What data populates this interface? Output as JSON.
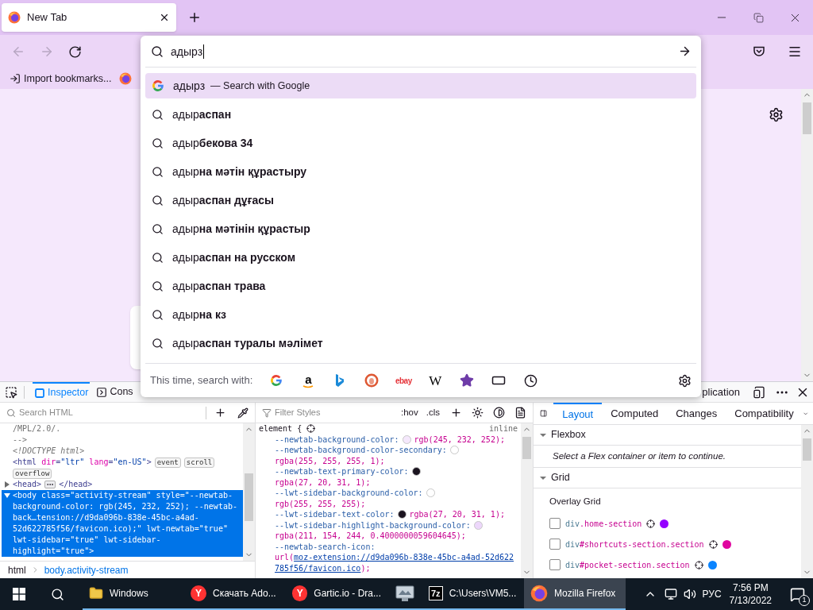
{
  "browser": {
    "tabs": [
      {
        "title": "New Tab",
        "selected": true
      }
    ],
    "bookmarks": [
      {
        "kind": "import",
        "label": "Import bookmarks..."
      },
      {
        "kind": "site"
      }
    ]
  },
  "address_bar": {
    "value": "адырз"
  },
  "suggestions": [
    {
      "kind": "engine",
      "text": "адырз",
      "action": "— Search with Google",
      "selected": true
    },
    {
      "kind": "query",
      "text": "адыр**аспан**",
      "selected": false
    },
    {
      "kind": "query",
      "text": "адыр**бекова 34**",
      "selected": false
    },
    {
      "kind": "query",
      "text": "адыр**на мәтін құрастыру**",
      "selected": false
    },
    {
      "kind": "query",
      "text": "адыр**аспан дұғасы**",
      "selected": false
    },
    {
      "kind": "query",
      "text": "адыр**на мәтінін құрастыр**",
      "selected": false
    },
    {
      "kind": "query",
      "text": "адыр**аспан на русском**",
      "selected": false
    },
    {
      "kind": "query",
      "text": "адыр**аспан трава**",
      "selected": false
    },
    {
      "kind": "query",
      "text": "адыр**на кз**",
      "selected": false
    },
    {
      "kind": "query",
      "text": "адыр**аспан туралы мәлімет**",
      "selected": false
    }
  ],
  "search_with": {
    "label": "This time, search with:",
    "engines": [
      {
        "kind": "google"
      },
      {
        "kind": "amazon",
        "glyph": "a"
      },
      {
        "kind": "bing"
      },
      {
        "kind": "duckduckgo"
      },
      {
        "kind": "ebay",
        "glyph": "ebay"
      },
      {
        "kind": "wikipedia",
        "glyph": "W"
      },
      {
        "kind": "bookmarks"
      },
      {
        "kind": "tabs"
      },
      {
        "kind": "history"
      }
    ]
  },
  "devtools": {
    "tabs": [
      {
        "kind": "inspector",
        "label": "Inspector",
        "selected": true
      },
      {
        "kind": "console",
        "label": "Cons",
        "selected": false
      },
      {
        "kind": "application",
        "label": "plication",
        "selected": false
      }
    ],
    "markup": {
      "search_placeholder": "Search HTML",
      "lines": [
        {
          "kind": "comment",
          "text": "/MPL/2.0/.",
          "selected": false
        },
        {
          "kind": "comment",
          "text": "-->",
          "selected": false
        },
        {
          "kind": "doctype",
          "text": "<!DOCTYPE html>",
          "selected": false
        },
        {
          "kind": "element",
          "segments": [
            {
              "kind": "tag",
              "text": "<html"
            },
            {
              "kind": "attr",
              "text": " dir"
            },
            {
              "kind": "tag",
              "text": "="
            },
            {
              "kind": "value",
              "text": "\"ltr\""
            },
            {
              "kind": "attr",
              "text": " lang"
            },
            {
              "kind": "tag",
              "text": "="
            },
            {
              "kind": "value",
              "text": "\"en-US\""
            },
            {
              "kind": "tag",
              "text": ">"
            }
          ],
          "badges": [
            "event",
            "scroll",
            "overflow"
          ],
          "selected": false
        },
        {
          "kind": "element",
          "segments": [
            {
              "kind": "tag",
              "text": "<head>"
            }
          ],
          "collapsed_content": true,
          "closing_tag": "</head>",
          "expanded": false,
          "selected": false
        },
        {
          "kind": "element",
          "text": "<body class=\"activity-stream\" style=\"--newtab-background-color: rgb(245, 232, 252); --newtab-back…tension://d9da096b-838e-45bc-a4ad-52d622785f56/favicon.ico);\" lwt-newtab=\"true\" lwt-sidebar=\"true\" lwt-sidebar-highlight=\"true\">",
          "expanded": true,
          "selected": true
        }
      ],
      "breadcrumbs": [
        {
          "label": "html",
          "selected": false
        },
        {
          "label": "body.activity-stream",
          "selected": true
        }
      ]
    },
    "rules": {
      "filter_placeholder": "Filter Styles",
      "toggles": [
        ":hov",
        ".cls"
      ],
      "selector": "element {",
      "source": "inline",
      "declarations": [
        {
          "name": "--newtab-background-color:",
          "color": "#f5e8fc",
          "value": "rgb(245, 232, 252);"
        },
        {
          "name": "--newtab-background-color-secondary:",
          "color": "#ffffff",
          "value": "rgba(255, 255, 255, 1);"
        },
        {
          "name": "--newtab-text-primary-color:",
          "color": "#1b141f",
          "value": "rgba(27, 20, 31, 1);"
        },
        {
          "name": "--lwt-sidebar-background-color:",
          "color": "#ffffff",
          "value": "rgb(255, 255, 255);"
        },
        {
          "name": "--lwt-sidebar-text-color:",
          "color": "#1b141f",
          "value": "rgba(27, 20, 31, 1);"
        },
        {
          "name": "--lwt-sidebar-highlight-background-color:",
          "color": "#edd7fb",
          "value": "rgba(211, 154, 244, 0.4000000059604645);"
        },
        {
          "name": "--newtab-search-icon:",
          "value": "url(",
          "link": "moz-extension://d9da096b-838e-45bc-a4ad-52d622785f56/favicon.ico",
          "value_end": ");"
        }
      ]
    },
    "layout": {
      "tabs": [
        {
          "label": "Layout",
          "selected": true
        },
        {
          "label": "Computed",
          "selected": false
        },
        {
          "label": "Changes",
          "selected": false
        },
        {
          "label": "Compatibility",
          "selected": false
        }
      ],
      "flexbox": {
        "title": "Flexbox",
        "expanded": true,
        "note": "Select a Flex container or item to continue."
      },
      "grid": {
        "title": "Grid",
        "expanded": true,
        "subtitle": "Overlay Grid",
        "items": [
          {
            "element": "div",
            "selector": ".home-section",
            "checked": false,
            "color": "#9400ff"
          },
          {
            "element": "div",
            "selector": "#shortcuts-section.section",
            "checked": false,
            "color": "#e0069f"
          },
          {
            "element": "div",
            "selector": "#pocket-section.section",
            "checked": false,
            "color": "#0a84ff"
          }
        ]
      }
    }
  },
  "taskbar": {
    "items": [
      {
        "kind": "explorer",
        "label": "Windows",
        "selected": false
      },
      {
        "kind": "yandex",
        "glyph": "Y",
        "label": "Скачать Ado...",
        "selected": false
      },
      {
        "kind": "yandex",
        "glyph": "Y",
        "label": "Gartic.io - Dra...",
        "selected": false
      },
      {
        "kind": "monitor",
        "selected": false
      },
      {
        "kind": "archiver",
        "glyph": "7z",
        "label": "C:\\Users\\VM5...",
        "selected": false
      },
      {
        "kind": "firefox",
        "label": "Mozilla Firefox",
        "selected": true
      }
    ],
    "tray": {
      "language": "РУС",
      "time": "7:56 PM",
      "date": "7/13/2022",
      "notifications": "1"
    }
  }
}
